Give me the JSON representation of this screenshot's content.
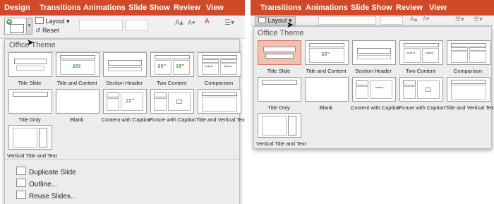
{
  "left_ribbon": {
    "tabs": [
      "Design",
      "Transitions",
      "Animations",
      "Slide Show",
      "Review",
      "View"
    ],
    "layout_label": "Layout",
    "reset_label": "Reset"
  },
  "right_ribbon": {
    "tabs": [
      "Transitions",
      "Animations",
      "Slide Show",
      "Review",
      "View"
    ],
    "layout_label": "Layout"
  },
  "gallery": {
    "title": "Office Theme",
    "layouts": [
      "Title Slide",
      "Title and Content",
      "Section Header",
      "Two Content",
      "Comparison",
      "Title Only",
      "Blank",
      "Content with Caption",
      "Picture with Caption",
      "Title and Vertical Text",
      "Vertical Title and Text"
    ],
    "selected_right": "Title Slide"
  },
  "menu": {
    "items": [
      "Duplicate Slide",
      "Outline...",
      "Reuse Slides..."
    ]
  },
  "colors": {
    "accent": "#d04a27",
    "selected": "#f2c0b0"
  }
}
